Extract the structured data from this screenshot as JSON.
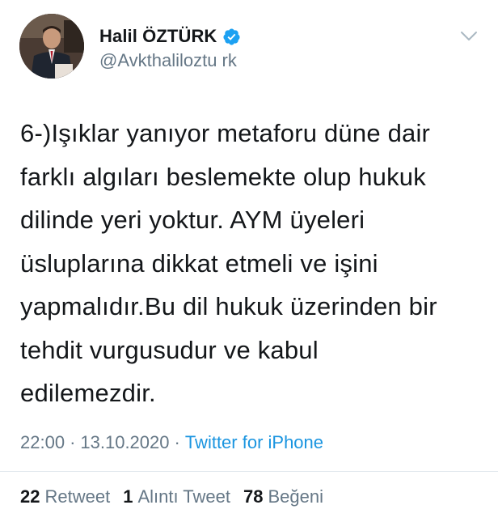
{
  "user": {
    "display_name": "Halil ÖZTÜRK",
    "handle": "@Avkthaliloztu rk",
    "verified": true
  },
  "icons": {
    "verified": "verified-badge-icon",
    "menu": "chevron-down-icon"
  },
  "tweet": {
    "text": "6-)Işıklar yanıyor metaforu düne dair\nfarklı algıları beslemekte olup hukuk\ndilinde yeri yoktur. AYM üyeleri\nüsluplarına dikkat etmeli ve işini\nyapmalıdır.Bu dil hukuk üzerinden bir\ntehdit vurgusudur ve kabul\nedilemezdir."
  },
  "meta": {
    "time": "22:00",
    "separator": "·",
    "date": "13.10.2020",
    "source": "Twitter for iPhone"
  },
  "stats": {
    "retweets_count": "22",
    "retweets_label": "Retweet",
    "quotes_count": "1",
    "quotes_label": "Alıntı Tweet",
    "likes_count": "78",
    "likes_label": "Beğeni"
  },
  "colors": {
    "primary_text": "#14171a",
    "secondary_text": "#657786",
    "link": "#1b95e0",
    "verified": "#1da1f2"
  }
}
